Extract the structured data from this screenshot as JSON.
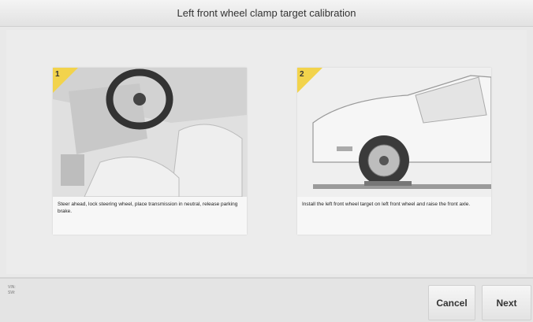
{
  "title": "Left front wheel clamp target calibration",
  "steps": [
    {
      "number": "1",
      "description": "Steer ahead, lock steering wheel, place transmission in neutral, release parking brake."
    },
    {
      "number": "2",
      "description": "Install the left front wheel target on left front wheel and raise the front axle."
    }
  ],
  "footer": {
    "meta_line1": "VIN:",
    "meta_line2": "SW:",
    "cancel_label": "Cancel",
    "next_label": "Next"
  },
  "colors": {
    "step_badge": "#f2d34c",
    "background": "#e9e9e9"
  }
}
